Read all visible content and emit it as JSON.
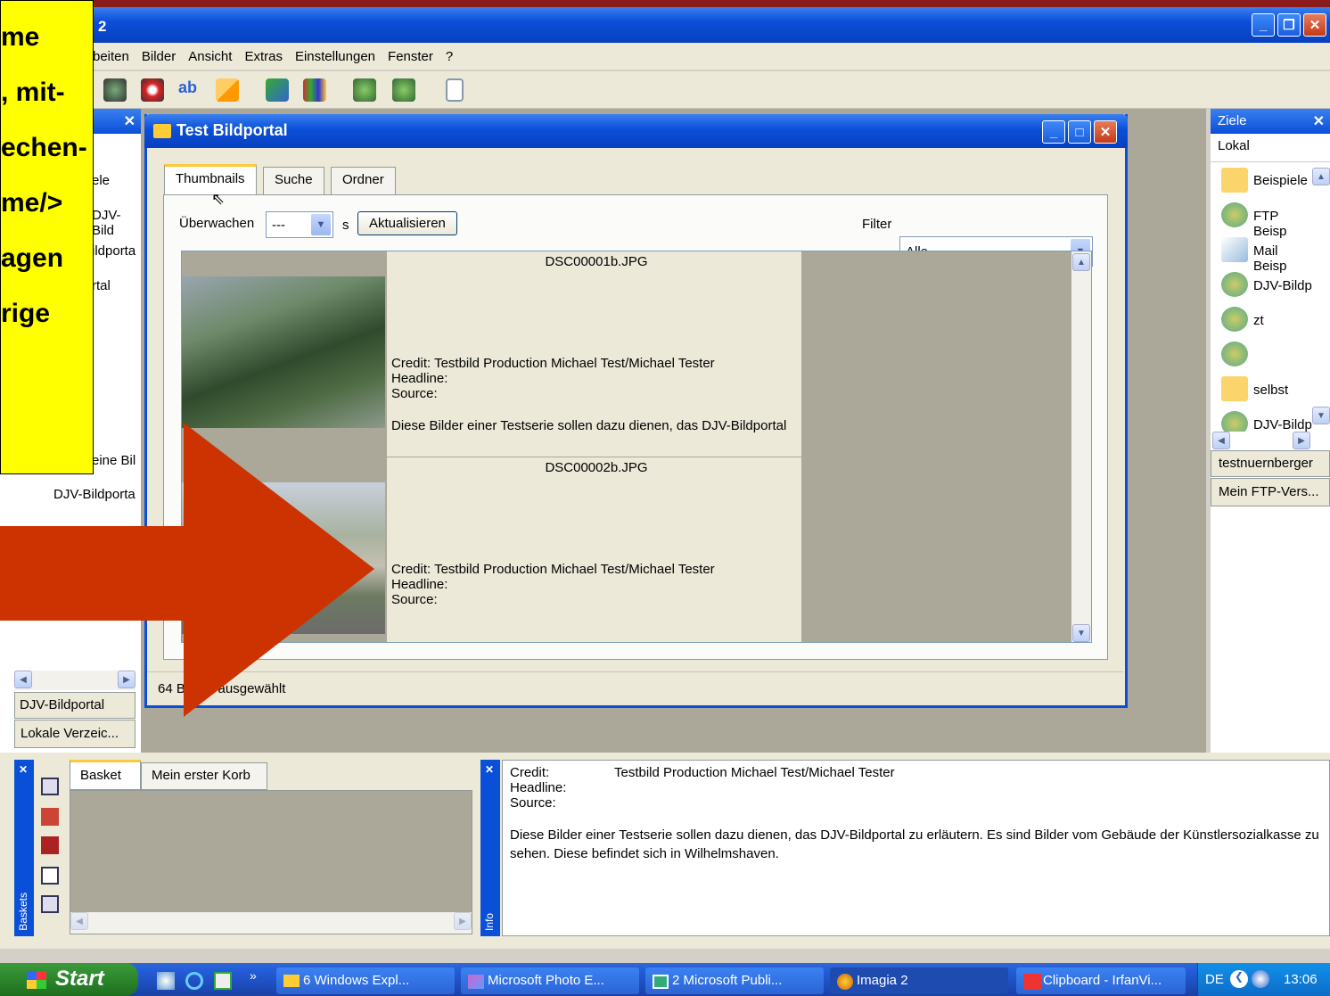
{
  "window": {
    "title": "2"
  },
  "menu": [
    "beiten",
    "Bilder",
    "Ansicht",
    "Extras",
    "Einstellungen",
    "Fenster",
    "?"
  ],
  "left_panel": {
    "items": [
      "ele",
      "DJV-Bild",
      "ildporta",
      "rtal",
      "eine Bil",
      "DJV-Bildporta"
    ],
    "tabs": [
      "DJV-Bildportal",
      "Lokale Verzeic..."
    ]
  },
  "child_window": {
    "title": "Test Bildportal",
    "tabs": [
      "Thumbnails",
      "Suche",
      "Ordner"
    ],
    "watch_label": "Überwachen",
    "watch_value": "---",
    "watch_unit": "s",
    "refresh_button": "Aktualisieren",
    "filter_label": "Filter",
    "filter_value": "Alle",
    "status": "0 ausgewählt",
    "status_prefix": "64 B"
  },
  "thumbnails": [
    {
      "filename": "DSC00001b.JPG",
      "credit": "Credit:  Testbild Production Michael Test/Michael Tester",
      "headline": "Headline:",
      "source": "Source:",
      "description": "Diese Bilder einer Testserie sollen dazu dienen, das DJV-Bildportal"
    },
    {
      "filename": "DSC00002b.JPG",
      "credit": "Credit:  Testbild Production Michael Test/Michael Tester",
      "headline": "Headline:",
      "source": "Source:"
    }
  ],
  "right_panel": {
    "title": "Ziele",
    "location": "Lokal",
    "items": [
      "Beispiele",
      "FTP Beisp",
      "Mail Beisp",
      "DJV-Bildp",
      "zt",
      "",
      "selbst",
      "DJV-Bildp"
    ],
    "tabs": [
      "testnuernberger",
      "Mein FTP-Vers..."
    ]
  },
  "baskets": {
    "vertical_label": "Baskets",
    "tabs": [
      "Basket",
      "Mein erster Korb"
    ]
  },
  "info": {
    "vertical_label": "Info",
    "credit_label": "Credit:",
    "credit_value": "Testbild Production Michael Test/Michael Tester",
    "headline_label": "Headline:",
    "source_label": "Source:",
    "description": "Diese Bilder einer Testserie sollen dazu dienen, das DJV-Bildportal zu erläutern. Es sind Bilder vom Gebäude der Künstlersozialkasse zu sehen. Diese befindet sich in Wilhelmshaven."
  },
  "taskbar": {
    "start": "Start",
    "tasks": [
      "6 Windows Expl...",
      "Microsoft Photo E...",
      "2 Microsoft Publi...",
      "Imagia 2",
      "Clipboard - IrfanVi..."
    ],
    "lang": "DE",
    "clock": "13:06"
  },
  "annotation": {
    "lines": [
      "me",
      ", mit-",
      "echen-",
      "me/>",
      "agen",
      "rige"
    ],
    "arrow_color": "#cc3300"
  }
}
